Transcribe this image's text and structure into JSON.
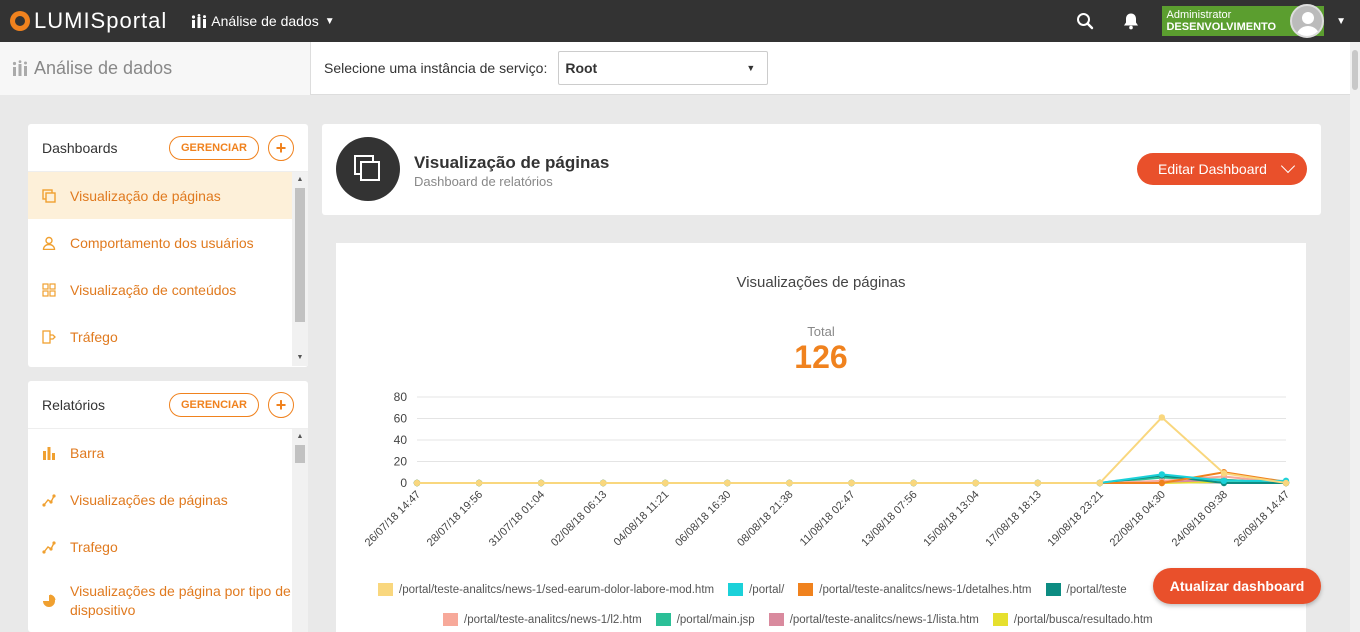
{
  "topbar": {
    "logo_light": "LUMIS",
    "logo_bold": "portal",
    "app_menu_label": "Análise de dados",
    "user_name": "Administrator",
    "user_env": "DESENVOLVIMENTO"
  },
  "subbar": {
    "title": "Análise de dados",
    "instance_label": "Selecione uma instância de serviço:",
    "instance_value": "Root"
  },
  "dashboards_panel": {
    "title": "Dashboards",
    "manage_label": "GERENCIAR",
    "add_label": "+",
    "items": [
      {
        "label": "Visualização de páginas",
        "icon": "copy-icon",
        "active": true
      },
      {
        "label": "Comportamento dos usuários",
        "icon": "user-icon"
      },
      {
        "label": "Visualização de conteúdos",
        "icon": "grid-icon"
      },
      {
        "label": "Tráfego",
        "icon": "traffic-icon"
      }
    ]
  },
  "reports_panel": {
    "title": "Relatórios",
    "manage_label": "GERENCIAR",
    "add_label": "+",
    "items": [
      {
        "label": "Barra",
        "icon": "bar-chart-icon"
      },
      {
        "label": "Visualizações de páginas",
        "icon": "line-chart-icon"
      },
      {
        "label": "Trafego",
        "icon": "line-chart-icon"
      },
      {
        "label": "Visualizações de página por tipo de dispositivo",
        "icon": "pie-chart-icon"
      }
    ]
  },
  "dashboard": {
    "title": "Visualização de páginas",
    "subtitle": "Dashboard de relatórios",
    "edit_label": "Editar Dashboard",
    "refresh_label": "Atualizar dashboard"
  },
  "chart_data": {
    "type": "line",
    "title": "Visualizações de páginas",
    "total_label": "Total",
    "total_value": "126",
    "ylim": [
      0,
      80
    ],
    "yticks": [
      0,
      20,
      40,
      60,
      80
    ],
    "grid": true,
    "legend_position": "bottom",
    "x": [
      "26/07/18 14:47",
      "28/07/18 19:56",
      "31/07/18 01:04",
      "02/08/18 06:13",
      "04/08/18 11:21",
      "06/08/18 16:30",
      "08/08/18 21:38",
      "11/08/18 02:47",
      "13/08/18 07:56",
      "15/08/18 13:04",
      "17/08/18 18:13",
      "19/08/18 23:21",
      "22/08/18 04:30",
      "24/08/18 09:38",
      "26/08/18 14:47"
    ],
    "series": [
      {
        "name": "/portal/teste-analitcs/news-1/sed-earum-dolor-labore-mod.htm",
        "color": "#f9d77e",
        "values": [
          0,
          0,
          0,
          0,
          0,
          0,
          0,
          0,
          0,
          0,
          0,
          0,
          61,
          9,
          0
        ]
      },
      {
        "name": "/portal/",
        "color": "#1bd1d9",
        "values": [
          0,
          0,
          0,
          0,
          0,
          0,
          0,
          0,
          0,
          0,
          0,
          0,
          8,
          2,
          2
        ]
      },
      {
        "name": "/portal/teste-analitcs/news-1/detalhes.htm",
        "color": "#f0821e",
        "values": [
          0,
          0,
          0,
          0,
          0,
          0,
          0,
          0,
          0,
          0,
          0,
          0,
          0,
          10,
          1
        ]
      },
      {
        "name": "/portal/teste",
        "color": "#0d8c82",
        "values": [
          0,
          0,
          0,
          0,
          0,
          0,
          0,
          0,
          0,
          0,
          0,
          0,
          7,
          0,
          0
        ]
      },
      {
        "name": "/portal/teste-analitcs/news-1/l2.htm",
        "color": "#f7a99a",
        "values": [
          0,
          0,
          0,
          0,
          0,
          0,
          0,
          0,
          0,
          0,
          0,
          0,
          2,
          6,
          0
        ]
      },
      {
        "name": "/portal/main.jsp",
        "color": "#2bbf97",
        "values": [
          0,
          0,
          0,
          0,
          0,
          0,
          0,
          0,
          0,
          0,
          0,
          0,
          5,
          3,
          0
        ]
      },
      {
        "name": "/portal/teste-analitcs/news-1/lista.htm",
        "color": "#d98a9e",
        "values": [
          0,
          0,
          0,
          0,
          0,
          0,
          0,
          0,
          0,
          0,
          0,
          0,
          1,
          3,
          0
        ]
      },
      {
        "name": "/portal/busca/resultado.htm",
        "color": "#e6e02e",
        "values": [
          0,
          0,
          0,
          0,
          0,
          0,
          0,
          0,
          0,
          0,
          0,
          0,
          0,
          1,
          0
        ]
      }
    ]
  }
}
